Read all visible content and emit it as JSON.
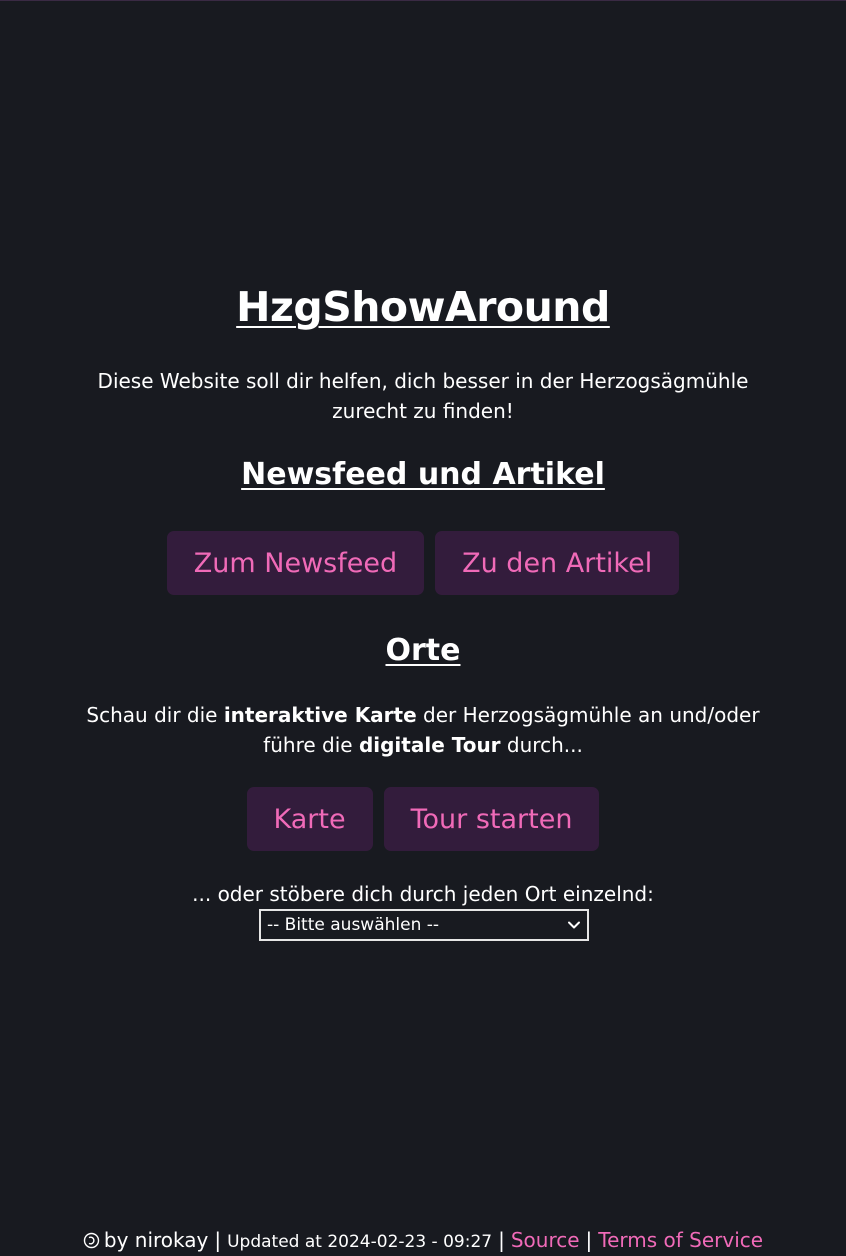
{
  "header": {
    "title": "HzgShowAround",
    "intro": "Diese Website soll dir helfen, dich besser in der Herzogsägmühle zurecht zu finden!"
  },
  "news_section": {
    "heading": "Newsfeed und Artikel",
    "newsfeed_button": "Zum Newsfeed",
    "articles_button": "Zu den Artikel"
  },
  "places_section": {
    "heading": "Orte",
    "text_part1": "Schau dir die ",
    "text_bold1": "interaktive Karte",
    "text_part2": " der Herzogsägmühle an und/oder führe die ",
    "text_bold2": "digitale Tour",
    "text_part3": " durch...",
    "map_button": "Karte",
    "tour_button": "Tour starten",
    "browse_text": "... oder stöbere dich durch jeden Ort einzelnd:",
    "select": {
      "selected": "-- Bitte auswählen --"
    }
  },
  "footer": {
    "copyright_icon": "copyleft-icon",
    "author": "by nirokay",
    "updated": "Updated at 2024-02-23 - 09:27",
    "source_link": "Source",
    "tos_link": "Terms of Service",
    "separator": "|"
  },
  "colors": {
    "background": "#181a20",
    "accent": "#f06ab8",
    "button_bg": "#331c3c",
    "text": "#ffffff"
  }
}
